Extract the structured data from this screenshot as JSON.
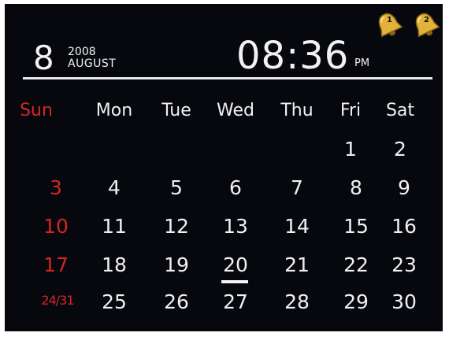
{
  "header": {
    "day": "8",
    "year": "2008",
    "month": "AUGUST",
    "time": "08:36",
    "ampm": "PM"
  },
  "alarms": [
    {
      "label": "1",
      "icon": "alarm-bell-icon"
    },
    {
      "label": "2",
      "icon": "alarm-bell-icon"
    }
  ],
  "calendar": {
    "weekdays": [
      "Sun",
      "Mon",
      "Tue",
      "Wed",
      "Thu",
      "Fri",
      "Sat"
    ],
    "weeks": [
      [
        "",
        "",
        "",
        "",
        "",
        "1",
        "2"
      ],
      [
        "3",
        "4",
        "5",
        "6",
        "7",
        "8",
        "9"
      ],
      [
        "10",
        "11",
        "12",
        "13",
        "14",
        "15",
        "16"
      ],
      [
        "17",
        "18",
        "19",
        "20",
        "21",
        "22",
        "23"
      ],
      [
        "24/31",
        "25",
        "26",
        "27",
        "28",
        "29",
        "30"
      ]
    ],
    "today": "20"
  },
  "colors": {
    "background": "#06080d",
    "text": "#f0f0f0",
    "sunday": "#d42424",
    "bell": "#e2b23a"
  }
}
